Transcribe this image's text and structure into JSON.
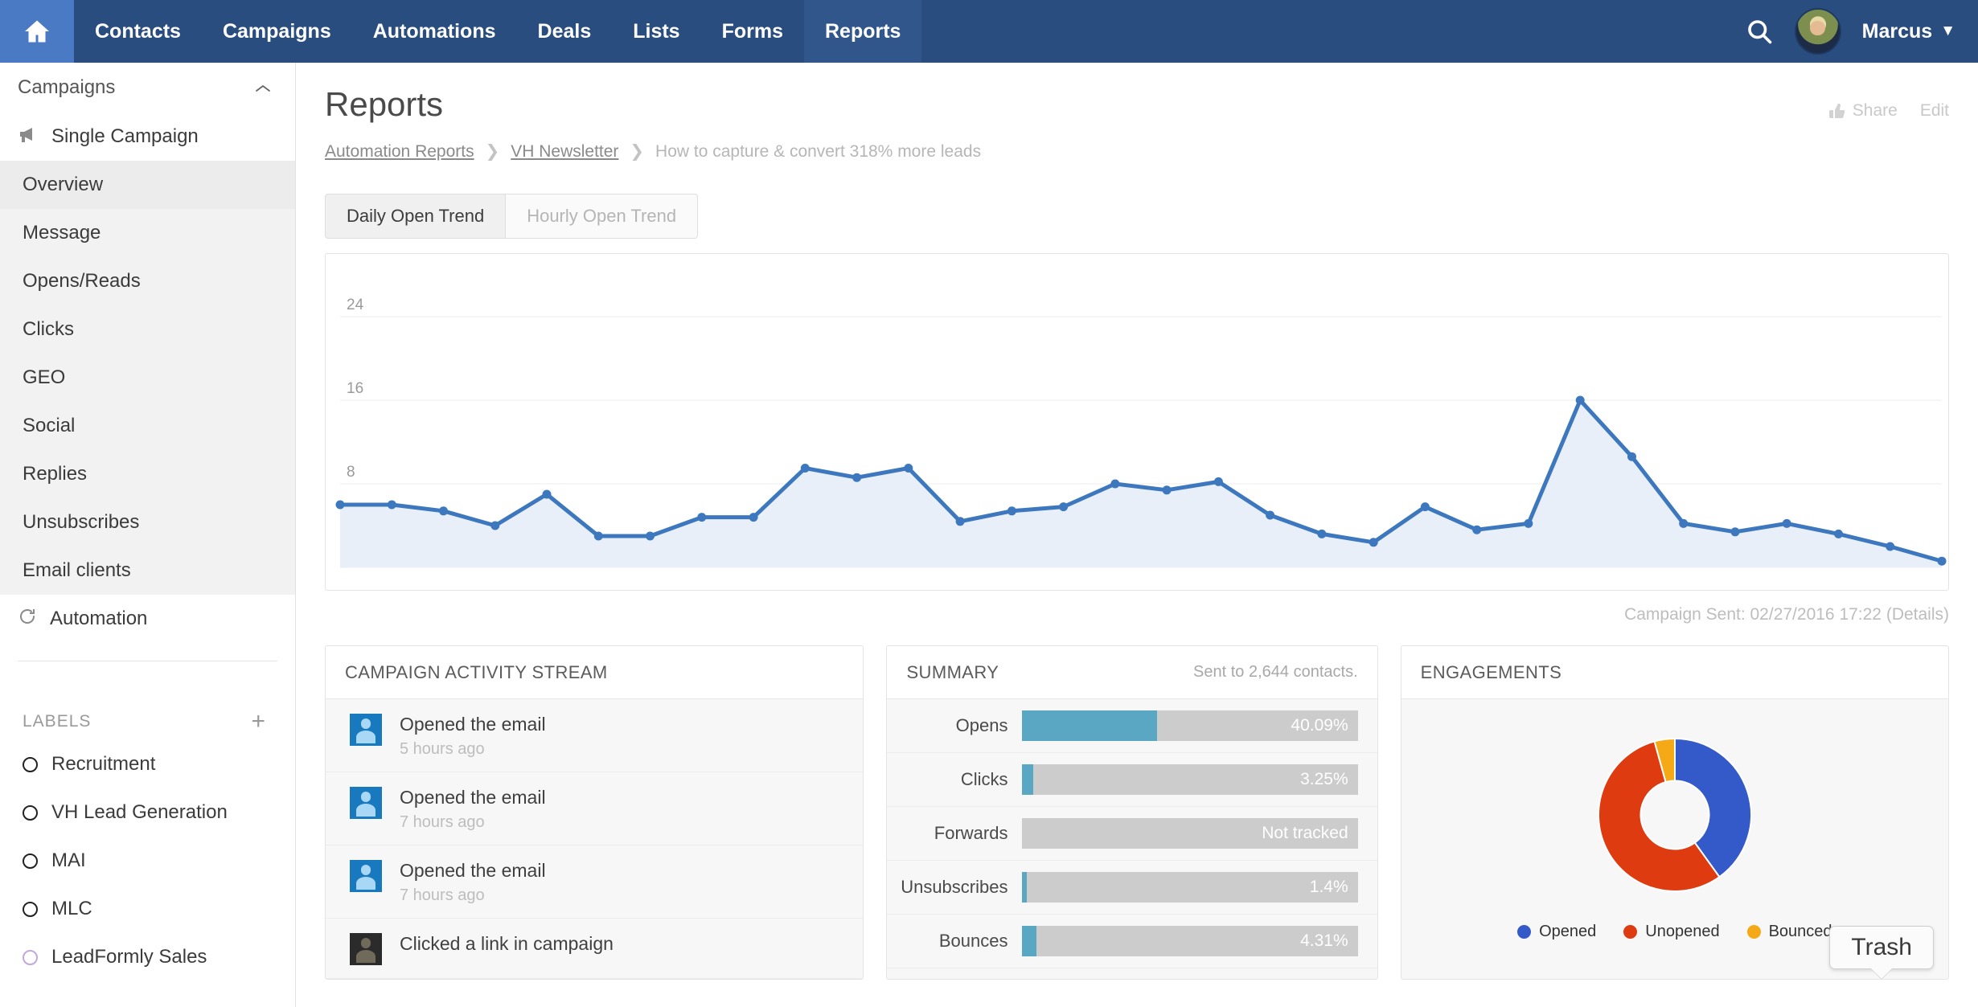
{
  "topnav": {
    "home_icon": "home-icon",
    "items": [
      {
        "label": "Contacts",
        "active": false
      },
      {
        "label": "Campaigns",
        "active": false
      },
      {
        "label": "Automations",
        "active": false
      },
      {
        "label": "Deals",
        "active": false
      },
      {
        "label": "Lists",
        "active": false
      },
      {
        "label": "Forms",
        "active": false
      },
      {
        "label": "Reports",
        "active": true
      }
    ],
    "search_icon": "search-icon",
    "user": "Marcus",
    "caret": "▼",
    "bg_color": "#2a4d7f",
    "active_color": "#30568c",
    "home_color": "#4a7ac4"
  },
  "sidebar": {
    "group_title": "Campaigns",
    "collapse_icon": "chevron-up-icon",
    "single_campaign": "Single Campaign",
    "items": [
      {
        "label": "Overview",
        "active": true
      },
      {
        "label": "Message",
        "active": false
      },
      {
        "label": "Opens/Reads",
        "active": false
      },
      {
        "label": "Clicks",
        "active": false
      },
      {
        "label": "GEO",
        "active": false
      },
      {
        "label": "Social",
        "active": false
      },
      {
        "label": "Replies",
        "active": false
      },
      {
        "label": "Unsubscribes",
        "active": false
      },
      {
        "label": "Email clients",
        "active": false
      }
    ],
    "automation": "Automation",
    "labels_title": "LABELS",
    "labels_add": "+",
    "labels": [
      {
        "label": "Recruitment",
        "color": "#222222"
      },
      {
        "label": "VH Lead Generation",
        "color": "#222222"
      },
      {
        "label": "MAI",
        "color": "#222222"
      },
      {
        "label": "MLC",
        "color": "#222222"
      },
      {
        "label": "LeadFormly Sales",
        "color": "#c0a8d8"
      }
    ]
  },
  "page": {
    "title": "Reports",
    "share_label": "Share",
    "edit_label": "Edit",
    "thumb_icon": "thumbs-up-icon",
    "breadcrumb": {
      "first": "Automation Reports",
      "second": "VH Newsletter",
      "current": "How to capture & convert 318% more leads",
      "separator": "❯"
    },
    "tabs": [
      {
        "label": "Daily Open Trend",
        "active": true
      },
      {
        "label": "Hourly Open Trend",
        "active": false
      }
    ],
    "sent_note": "Campaign Sent: 02/27/2016 17:22 (Details)"
  },
  "chart_data": {
    "type": "area",
    "title": "Daily Open Trend",
    "xlabel": "",
    "ylabel": "",
    "ylim": [
      0,
      28
    ],
    "yticks": [
      8,
      16,
      24
    ],
    "grid": true,
    "legend": "none",
    "line_color": "#3d78bf",
    "fill_color": "#e8eff8",
    "x": [
      1,
      2,
      3,
      4,
      5,
      6,
      7,
      8,
      9,
      10,
      11,
      12,
      13,
      14,
      15,
      16,
      17,
      18,
      19,
      20,
      21,
      22,
      23,
      24,
      25,
      26,
      27,
      28,
      29,
      30,
      31,
      32
    ],
    "values": [
      6,
      6,
      5.4,
      4,
      7,
      3,
      3,
      4.8,
      4.8,
      9.5,
      8.6,
      9.5,
      4.4,
      5.4,
      5.8,
      8,
      7.4,
      8.2,
      5,
      3.2,
      2.4,
      5.8,
      3.6,
      4.2,
      16,
      10.6,
      4.2,
      3.4,
      4.2,
      3.2,
      2,
      0.6
    ]
  },
  "activity": {
    "title": "CAMPAIGN ACTIVITY STREAM",
    "rows": [
      {
        "title": "Opened the email",
        "time": "5 hours ago",
        "avatar": "contact-avatar"
      },
      {
        "title": "Opened the email",
        "time": "7 hours ago",
        "avatar": "contact-avatar"
      },
      {
        "title": "Opened the email",
        "time": "7 hours ago",
        "avatar": "contact-avatar"
      },
      {
        "title": "Clicked a link in campaign",
        "time": "",
        "avatar": "contact-avatar-dark"
      }
    ]
  },
  "summary": {
    "title": "SUMMARY",
    "sent_to": "Sent to 2,644 contacts.",
    "bar_color": "#5aa7c4",
    "track_color": "#cccccc",
    "rows": [
      {
        "label": "Opens",
        "value": "40.09%",
        "pct": 40.09
      },
      {
        "label": "Clicks",
        "value": "3.25%",
        "pct": 3.25
      },
      {
        "label": "Forwards",
        "value": "Not tracked",
        "pct": 0
      },
      {
        "label": "Unsubscribes",
        "value": "1.4%",
        "pct": 1.4
      },
      {
        "label": "Bounces",
        "value": "4.31%",
        "pct": 4.31
      }
    ]
  },
  "engagements": {
    "title": "ENGAGEMENTS",
    "chart": {
      "type": "pie",
      "labels": [
        "Opened",
        "Unopened",
        "Bounced"
      ],
      "values": [
        40.09,
        55.6,
        4.31
      ],
      "colors": [
        "#3459c9",
        "#df3b10",
        "#f5a916"
      ]
    }
  },
  "tooltip": {
    "trash_label": "Trash"
  }
}
